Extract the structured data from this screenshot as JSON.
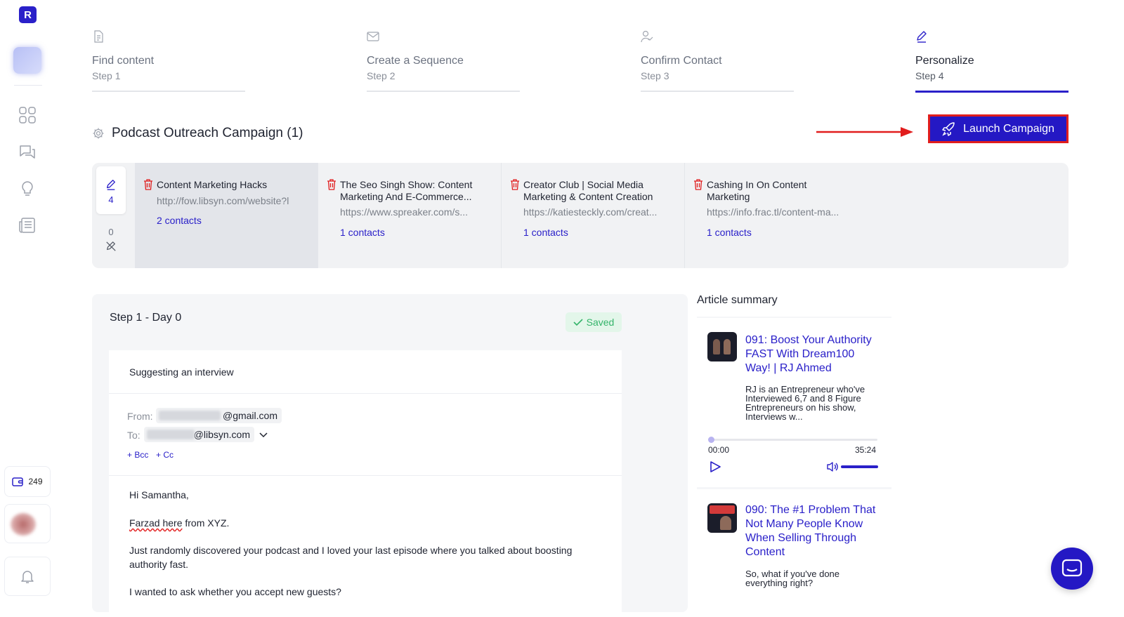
{
  "sidebar": {
    "logo_letter": "R",
    "credits_count": "249",
    "nav_icons": [
      "grid-icon",
      "chat-icon",
      "lightbulb-icon",
      "newspaper-icon"
    ]
  },
  "steps": [
    {
      "title": "Find content",
      "sub": "Step 1",
      "icon": "document-icon"
    },
    {
      "title": "Create a Sequence",
      "sub": "Step 2",
      "icon": "mail-icon"
    },
    {
      "title": "Confirm Contact",
      "sub": "Step 3",
      "icon": "user-check-icon"
    },
    {
      "title": "Personalize",
      "sub": "Step 4",
      "icon": "pencil-icon",
      "active": true
    }
  ],
  "campaign": {
    "title": "Podcast Outreach Campaign (1)",
    "launch_label": "Launch Campaign"
  },
  "mini_counts": {
    "edited": "4",
    "unedited": "0"
  },
  "content_cards": [
    {
      "title": "Content Marketing Hacks",
      "url": "http://fow.libsyn.com/website?l",
      "contacts": "2 contacts",
      "active": true
    },
    {
      "title": "The Seo Singh Show: Content Marketing And E-Commerce...",
      "url": "https://www.spreaker.com/s...",
      "contacts": "1 contacts"
    },
    {
      "title": "Creator Club | Social Media Marketing & Content Creation",
      "url": "https://katiesteckly.com/creat...",
      "contacts": "1 contacts"
    },
    {
      "title": "Cashing In On Content Marketing",
      "url": "https://info.frac.tl/content-ma...",
      "contacts": "1 contacts"
    }
  ],
  "editor": {
    "step_label": "Step 1 - Day 0",
    "saved_label": "Saved",
    "subject": "Suggesting an interview",
    "from_label": "From:",
    "from_value": "@gmail.com",
    "to_label": "To:",
    "to_value": "@libsyn.com",
    "bcc_label": "+ Bcc",
    "cc_label": "+ Cc",
    "body": {
      "greeting": "Hi Samantha,",
      "intro_word": "Farzad here",
      "intro_rest": " from XYZ.",
      "p1": "Just randomly discovered your podcast and I loved your last episode where you talked about boosting authority fast.",
      "p2": "I wanted to ask whether you accept new guests?"
    }
  },
  "summary": {
    "title": "Article summary",
    "articles": [
      {
        "title": "091: Boost Your Authority FAST With Dream100 Way! | RJ Ahmed",
        "desc": "RJ is an Entrepreneur who've Interviewed 6,7 and 8 Figure Entrepreneurs on his show, Interviews w...",
        "time_start": "00:00",
        "time_end": "35:24",
        "progress": 0.0
      },
      {
        "title": "090: The #1 Problem That Not Many People Know When Selling Through Content",
        "desc": "So, what if you've done everything right?"
      }
    ]
  },
  "colors": {
    "accent": "#2a20c9",
    "launch_border": "#e11d1d",
    "delete": "#e11d1d",
    "saved": "#34b46a"
  }
}
